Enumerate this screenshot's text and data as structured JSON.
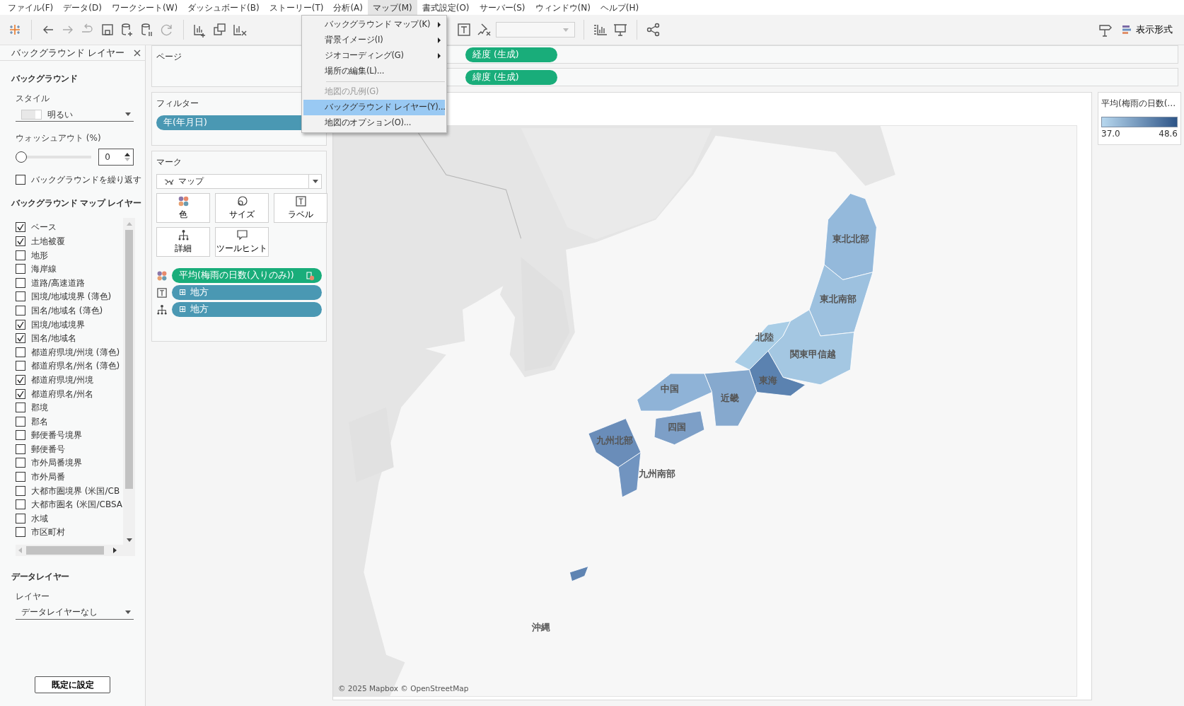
{
  "menu_bar": [
    {
      "label": "ファイル(F)",
      "selected": false
    },
    {
      "label": "データ(D)",
      "selected": false
    },
    {
      "label": "ワークシート(W)",
      "selected": false
    },
    {
      "label": "ダッシュボード(B)",
      "selected": false
    },
    {
      "label": "ストーリー(T)",
      "selected": false
    },
    {
      "label": "分析(A)",
      "selected": false
    },
    {
      "label": "マップ(M)",
      "selected": true
    },
    {
      "label": "書式設定(O)",
      "selected": false
    },
    {
      "label": "サーバー(S)",
      "selected": false
    },
    {
      "label": "ウィンドウ(N)",
      "selected": false
    },
    {
      "label": "ヘルプ(H)",
      "selected": false
    }
  ],
  "toolbar": {
    "format_button": "表示形式"
  },
  "map_menu": [
    [
      {
        "label": "バックグラウンド マップ(K)",
        "submenu": true,
        "disabled": false,
        "selected": false
      },
      {
        "label": "背景イメージ(I)",
        "submenu": true,
        "disabled": false,
        "selected": false
      },
      {
        "label": "ジオコーディング(G)",
        "submenu": true,
        "disabled": false,
        "selected": false
      },
      {
        "label": "場所の編集(L)...",
        "submenu": false,
        "disabled": false,
        "selected": false
      }
    ],
    [
      {
        "label": "地図の凡例(G)",
        "submenu": false,
        "disabled": true,
        "selected": false
      },
      {
        "label": "バックグラウンド レイヤー(Y)...",
        "submenu": false,
        "disabled": false,
        "selected": true
      },
      {
        "label": "地図のオプション(O)...",
        "submenu": false,
        "disabled": false,
        "selected": false
      }
    ]
  ],
  "side_panel": {
    "title": "バックグラウンド レイヤー",
    "background_heading": "バックグラウンド",
    "style_label": "スタイル",
    "style_value": "明るい",
    "washout_label": "ウォッシュアウト (%)",
    "washout_value": "0",
    "washout": {
      "level": 0
    },
    "repeat": {
      "label": "バックグラウンドを繰り返す",
      "checked": false
    },
    "layers_heading": "バックグラウンド マップ レイヤー",
    "layers": [
      {
        "label": "ベース",
        "checked": true
      },
      {
        "label": "土地被覆",
        "checked": true
      },
      {
        "label": "地形",
        "checked": false
      },
      {
        "label": "海岸線",
        "checked": false
      },
      {
        "label": "道路/高速道路",
        "checked": false
      },
      {
        "label": "国境/地域境界 (薄色)",
        "checked": false
      },
      {
        "label": "国名/地域名 (薄色)",
        "checked": false
      },
      {
        "label": "国境/地域境界",
        "checked": true
      },
      {
        "label": "国名/地域名",
        "checked": true
      },
      {
        "label": "都道府県境/州境 (薄色)",
        "checked": false
      },
      {
        "label": "都道府県名/州名 (薄色)",
        "checked": false
      },
      {
        "label": "都道府県境/州境",
        "checked": true
      },
      {
        "label": "都道府県名/州名",
        "checked": true
      },
      {
        "label": "郡境",
        "checked": false
      },
      {
        "label": "郡名",
        "checked": false
      },
      {
        "label": "郵便番号境界",
        "checked": false
      },
      {
        "label": "郵便番号",
        "checked": false
      },
      {
        "label": "市外局番境界",
        "checked": false
      },
      {
        "label": "市外局番",
        "checked": false
      },
      {
        "label": "大都市圏境界 (米国/CB",
        "checked": false
      },
      {
        "label": "大都市圏名 (米国/CBSA",
        "checked": false
      },
      {
        "label": "水域",
        "checked": false
      },
      {
        "label": "市区町村",
        "checked": false
      }
    ],
    "data_heading": "データレイヤー",
    "layer_label": "レイヤー",
    "layer_value": "データレイヤーなし",
    "default_button": "既定に設定"
  },
  "pages": {
    "title": "ページ"
  },
  "filters": {
    "title": "フィルター",
    "pills": [
      "年(年月日)"
    ]
  },
  "marks": {
    "title": "マーク",
    "type": "マップ",
    "cards": [
      {
        "kind": "color",
        "label": "色"
      },
      {
        "kind": "size",
        "label": "サイズ"
      },
      {
        "kind": "label",
        "label": "ラベル"
      },
      {
        "kind": "detail",
        "label": "詳細"
      },
      {
        "kind": "tooltip",
        "label": "ツールヒント"
      }
    ],
    "fields": [
      {
        "kind": "color",
        "label": "平均(梅雨の日数(入りのみ))",
        "color": "#19ad7a"
      },
      {
        "kind": "label",
        "expander": "⊞",
        "label": "地方",
        "color": "#4a98b3"
      },
      {
        "kind": "detail",
        "expander": "⊞",
        "label": "地方",
        "color": "#4a98b3"
      }
    ]
  },
  "columns_shelf": {
    "pills": [
      "経度 (生成)"
    ]
  },
  "rows_shelf": {
    "pills": [
      "緯度 (生成)"
    ]
  },
  "map": {
    "regions": [
      {
        "label": "東北北部",
        "color": "#94b9db"
      },
      {
        "label": "東北南部",
        "color": "#9dc1df"
      },
      {
        "label": "北陸",
        "color": "#a9cde6"
      },
      {
        "label": "関東甲信越",
        "color": "#a4c7e2"
      },
      {
        "label": "東海",
        "color": "#5b82b0"
      },
      {
        "label": "近畿",
        "color": "#86a9ce"
      },
      {
        "label": "中国",
        "color": "#8fb3d7"
      },
      {
        "label": "四国",
        "color": "#7d9fc7"
      },
      {
        "label": "九州北部",
        "color": "#6a8db9"
      },
      {
        "label": "九州南部",
        "color": "#7194c0"
      },
      {
        "label": "沖縄",
        "color": "#5f84b2"
      }
    ],
    "attribution": "© 2025 Mapbox © OpenStreetMap"
  },
  "legend": {
    "title": "平均(梅雨の日数(…",
    "min": "37.0",
    "max": "48.6"
  }
}
